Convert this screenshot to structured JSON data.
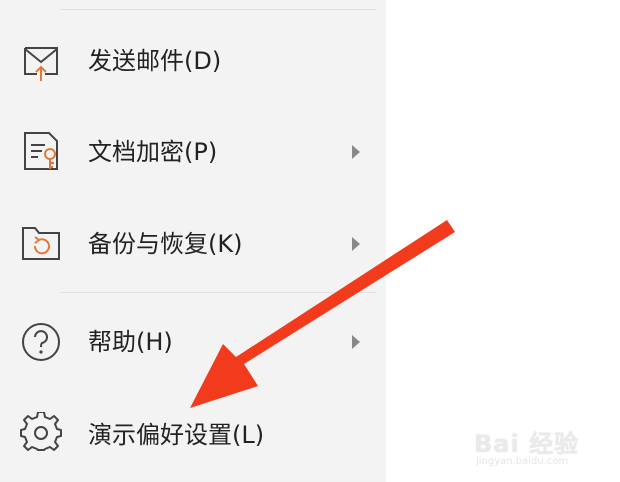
{
  "menu": {
    "items": [
      {
        "label": "发送邮件(D)",
        "icon": "mail-send-icon",
        "has_submenu": false
      },
      {
        "label": "文档加密(P)",
        "icon": "document-key-icon",
        "has_submenu": true
      },
      {
        "label": "备份与恢复(K)",
        "icon": "folder-restore-icon",
        "has_submenu": true
      },
      {
        "label": "帮助(H)",
        "icon": "help-circle-icon",
        "has_submenu": true
      },
      {
        "label": "演示偏好设置(L)",
        "icon": "gear-icon",
        "has_submenu": false
      }
    ]
  },
  "colors": {
    "panel_bg": "#f3f3f3",
    "icon_stroke": "#444444",
    "icon_accent": "#e07a3a",
    "annotation_arrow": "#f23a1c"
  },
  "watermark": {
    "logo_text": "Bai 经验",
    "sub_text": "jingyan.baidu.com"
  }
}
